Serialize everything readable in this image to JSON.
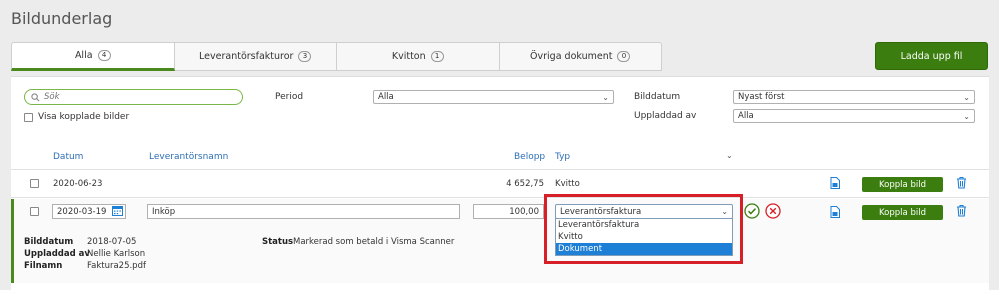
{
  "page": {
    "title": "Bildunderlag"
  },
  "tabs": [
    {
      "label": "Alla",
      "count": "4",
      "active": true
    },
    {
      "label": "Leverantörsfakturor",
      "count": "3",
      "active": false
    },
    {
      "label": "Kvitton",
      "count": "1",
      "active": false
    },
    {
      "label": "Övriga dokument",
      "count": "0",
      "active": false
    }
  ],
  "upload_label": "Ladda upp fil",
  "filters": {
    "search_placeholder": "Sök",
    "show_linked_label": "Visa kopplade bilder",
    "period_label": "Period",
    "period_value": "Alla",
    "image_date_label": "Bilddatum",
    "image_date_value": "Nyast först",
    "uploaded_by_label": "Uppladdad av",
    "uploaded_by_value": "Alla"
  },
  "columns": {
    "date": "Datum",
    "supplier": "Leverantörsnamn",
    "amount": "Belopp",
    "type": "Typ"
  },
  "rows": [
    {
      "date": "2020-06-23",
      "supplier": "",
      "amount": "4 652,75",
      "type": "Kvitto",
      "action": "Koppla bild"
    }
  ],
  "edit_row": {
    "date": "2020-03-19",
    "supplier": "Inköp",
    "amount": "100,00",
    "type": "Leverantörsfaktura",
    "action": "Koppla bild",
    "options": [
      "Leverantörsfaktura",
      "Kvitto",
      "Dokument"
    ],
    "highlighted_option": "Dokument"
  },
  "details": {
    "image_date_label": "Bilddatum",
    "image_date_value": "2018-07-05",
    "uploaded_by_label": "Uppladdad av",
    "uploaded_by_value": "Nellie Karlson",
    "filename_label": "Filnamn",
    "filename_value": "Faktura25.pdf",
    "status_label": "Status",
    "status_value": "Markerad som betald i Visma Scanner"
  },
  "colors": {
    "green": "#3b7d0f",
    "link_blue": "#2e6fb5",
    "highlight_red": "#d61f26",
    "selection_blue": "#1e7fd6"
  }
}
